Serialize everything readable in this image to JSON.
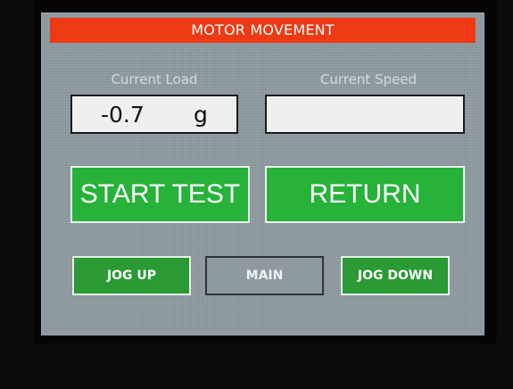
{
  "screen": {
    "title": "MOTOR MOVEMENT",
    "title_color": "#ee3a14",
    "button_color": "#27b23a"
  },
  "fields": {
    "current_load_label": "Current Load",
    "current_load_value": "-0.7",
    "current_load_unit": "g",
    "current_speed_label": "Current Speed",
    "current_speed_value": ""
  },
  "buttons": {
    "start_test": "START TEST",
    "return": "RETURN",
    "jog_up": "JOG UP",
    "main": "MAIN",
    "jog_down": "JOG DOWN"
  }
}
